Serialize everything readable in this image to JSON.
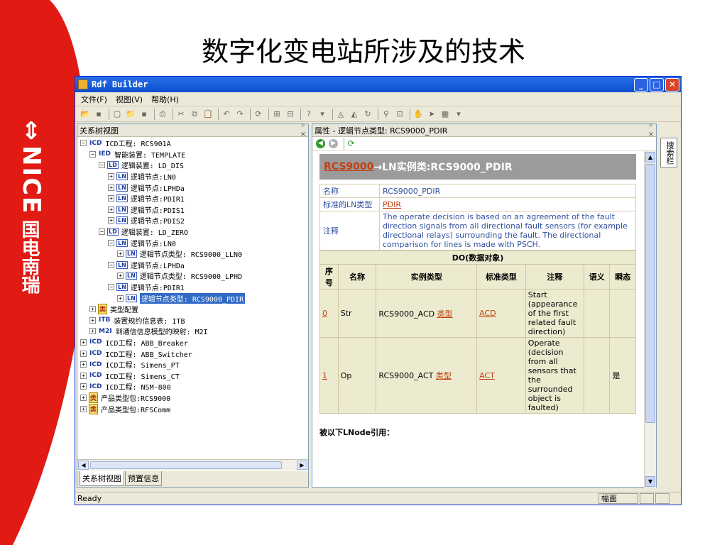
{
  "slide": {
    "title": "数字化变电站所涉及的技术",
    "brand_en": "NICE",
    "brand_cn": "国电南瑞",
    "brand_symbol": "⇕"
  },
  "window": {
    "title": "Rdf Builder",
    "menus": [
      "文件(F)",
      "视图(V)",
      "帮助(H)"
    ],
    "controls": {
      "minimize": "_",
      "maximize": "□",
      "close": "✕"
    }
  },
  "left_panel": {
    "title": "关系树视图",
    "pin": "ᵖ ×",
    "tree": [
      {
        "depth": 0,
        "toggle": "−",
        "badge": "ICD",
        "text": "ICD工程: RCS901A"
      },
      {
        "depth": 1,
        "toggle": "−",
        "badge": "IED",
        "text": "智能装置: TEMPLATE"
      },
      {
        "depth": 2,
        "toggle": "−",
        "badge": "LD",
        "text": "逻辑装置: LD_DIS"
      },
      {
        "depth": 3,
        "toggle": "+",
        "badge": "LN",
        "text": "逻辑节点:LN0"
      },
      {
        "depth": 3,
        "toggle": "+",
        "badge": "LN",
        "text": "逻辑节点:LPHDa"
      },
      {
        "depth": 3,
        "toggle": "+",
        "badge": "LN",
        "text": "逻辑节点:PDIR1"
      },
      {
        "depth": 3,
        "toggle": "+",
        "badge": "LN",
        "text": "逻辑节点:PDIS1"
      },
      {
        "depth": 3,
        "toggle": "+",
        "badge": "LN",
        "text": "逻辑节点:PDIS2"
      },
      {
        "depth": 2,
        "toggle": "−",
        "badge": "LD",
        "text": "逻辑装置: LD_ZERO"
      },
      {
        "depth": 3,
        "toggle": "−",
        "badge": "LN",
        "text": "逻辑节点:LN0"
      },
      {
        "depth": 4,
        "toggle": "+",
        "badge": "LN",
        "text": "逻辑节点类型: RCS9000_LLN0"
      },
      {
        "depth": 3,
        "toggle": "−",
        "badge": "LN",
        "text": "逻辑节点:LPHDa"
      },
      {
        "depth": 4,
        "toggle": "+",
        "badge": "LN",
        "text": "逻辑节点类型: RCS9000_LPHD"
      },
      {
        "depth": 3,
        "toggle": "−",
        "badge": "LN",
        "text": "逻辑节点:PDIR1"
      },
      {
        "depth": 4,
        "toggle": "+",
        "badge": "LN",
        "text": "逻辑节点类型: RCS9000_PDIR",
        "selected": true
      },
      {
        "depth": 1,
        "toggle": "+",
        "badge": "类",
        "text": "类型配置"
      },
      {
        "depth": 1,
        "toggle": "+",
        "badge": "ITB",
        "text": "装置规约信息表: ITB"
      },
      {
        "depth": 1,
        "toggle": "+",
        "badge": "M2I",
        "text": "到通信信息模型的映射: M2I"
      },
      {
        "depth": 0,
        "toggle": "+",
        "badge": "ICD",
        "text": "ICD工程: ABB_Breaker"
      },
      {
        "depth": 0,
        "toggle": "+",
        "badge": "ICD",
        "text": "ICD工程: ABB_Switcher"
      },
      {
        "depth": 0,
        "toggle": "+",
        "badge": "ICD",
        "text": "ICD工程: Simens_PT"
      },
      {
        "depth": 0,
        "toggle": "+",
        "badge": "ICD",
        "text": "ICD工程: Simens_CT"
      },
      {
        "depth": 0,
        "toggle": "+",
        "badge": "ICD",
        "text": "ICD工程: NSM-800"
      },
      {
        "depth": 0,
        "toggle": "+",
        "badge": "类",
        "text": "产品类型包:RCS9000"
      },
      {
        "depth": 0,
        "toggle": "+",
        "badge": "类",
        "text": "产品类型包:RFSComm"
      }
    ],
    "tabs": [
      "关系树视图",
      "预置信息"
    ]
  },
  "right_panel": {
    "title": "属性 - 逻辑节点类型: RCS9000_PDIR",
    "pin": "ᵖ ×",
    "header_link": "RCS9000",
    "header_rest": "→LN实例类:RCS9000_PDIR",
    "props": {
      "name_key": "名称",
      "name_val": "RCS9000_PDIR",
      "std_key": "标准的LN类型",
      "std_val": "PDIR",
      "note_key": "注释",
      "note_val": "The operate decision is based on an agreement of the fault direction signals from all directional fault sensors (for example directional relays) surrounding the fault. The directional comparison for lines is made with PSCH."
    },
    "do_table": {
      "caption": "DO(数据对象)",
      "headers": [
        "序号",
        "名称",
        "实例类型",
        "标准类型",
        "注释",
        "语义",
        "瞬态"
      ],
      "rows": [
        {
          "no": "0",
          "name": "Str",
          "inst": "RCS9000_ACD",
          "type_link": "类型",
          "std": "ACD",
          "note": "Start (appearance of the first related fault direction)",
          "sem": "",
          "trans": ""
        },
        {
          "no": "1",
          "name": "Op",
          "inst": "RCS9000_ACT",
          "type_link": "类型",
          "std": "ACT",
          "note": "Operate (decision from all sensors that the surrounded object is faulted)",
          "sem": "",
          "trans": "是"
        }
      ]
    },
    "refs_label": "被以下LNode引用："
  },
  "side_tab": "搜索栏",
  "status": {
    "text": "Ready",
    "cell": "幅面"
  }
}
